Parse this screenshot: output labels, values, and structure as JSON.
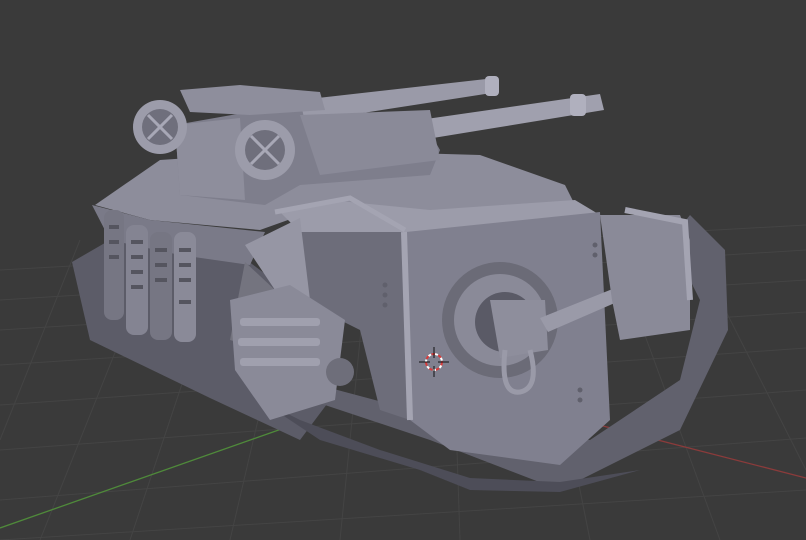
{
  "viewport": {
    "background_color": "#3a3a3a",
    "grid_color": "#444444",
    "x_axis_color": "#8b3b3b",
    "y_axis_color": "#4f8a3a",
    "model_color": "#80808f",
    "model_shadow_color": "#5c5c68",
    "model_highlight_color": "#a4a4b2",
    "cursor_icon": "3d-cursor-icon"
  }
}
